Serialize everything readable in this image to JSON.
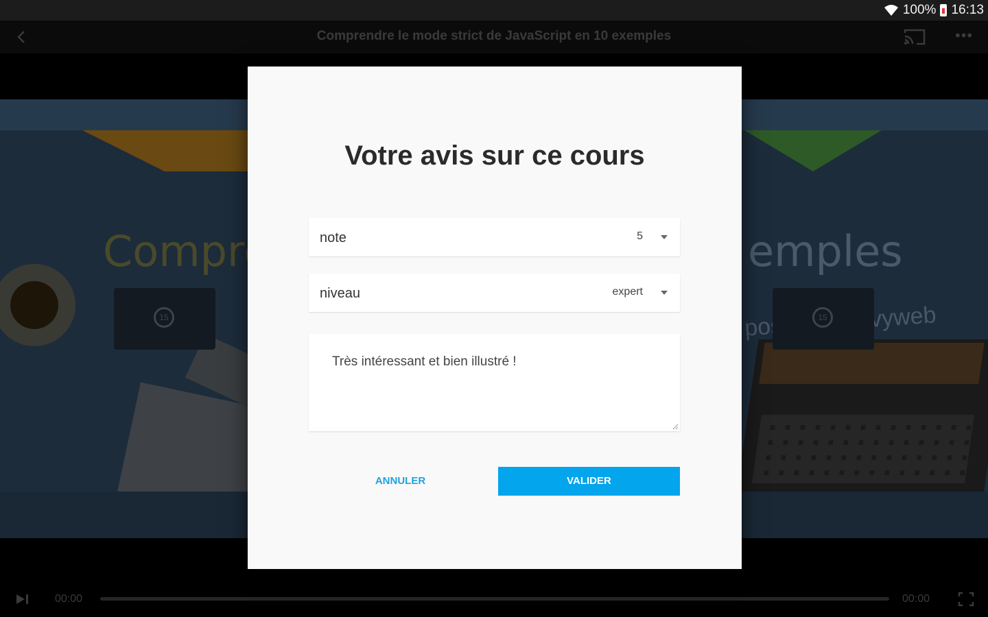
{
  "status_bar": {
    "battery": "100%",
    "time": "16:13"
  },
  "app_bar": {
    "title": "Comprendre le mode strict de JavaScript en 10 exemples"
  },
  "video": {
    "bg_title_left": "Compre",
    "bg_title_right": "emples",
    "bg_subtitle_right": "posée par Evyweb",
    "rewind_label": "15",
    "forward_label": "15"
  },
  "player": {
    "current_time": "00:00",
    "total_time": "00:00"
  },
  "dialog": {
    "title": "Votre avis sur ce cours",
    "note": {
      "label": "note",
      "value": "5"
    },
    "niveau": {
      "label": "niveau",
      "value": "expert"
    },
    "comment": "Très intéressant et bien illustré !",
    "cancel_label": "ANNULER",
    "submit_label": "VALIDER"
  },
  "colors": {
    "accent": "#03a5ec",
    "link": "#1fa3e0"
  }
}
